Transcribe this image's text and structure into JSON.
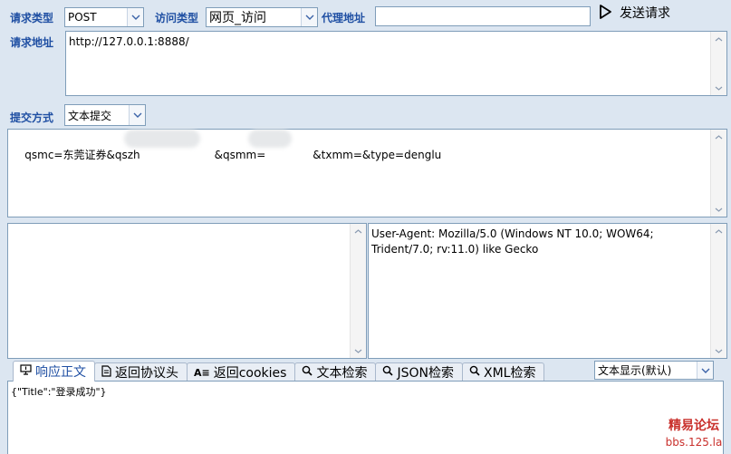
{
  "toolbar": {
    "request_type_label": "请求类型",
    "request_type_value": "POST",
    "access_type_label": "访问类型",
    "access_type_value": "网页_访问",
    "proxy_label": "代理地址",
    "proxy_value": "",
    "send_label": "发送请求"
  },
  "url": {
    "label": "请求地址",
    "value": "http://127.0.0.1:8888/"
  },
  "submit": {
    "label": "提交方式",
    "value": "文本提交",
    "body_parts": [
      "qsmc=东莞证券&qszh",
      "&qsmm=",
      "&txmm=&type=denglu"
    ]
  },
  "headers": {
    "left_value": "",
    "right_value": "User-Agent: Mozilla/5.0 (Windows NT 10.0; WOW64;\nTrident/7.0; rv:11.0) like Gecko"
  },
  "tabs": [
    {
      "label": "响应正文",
      "icon": "monitor-icon"
    },
    {
      "label": "返回协议头",
      "icon": "document-icon"
    },
    {
      "label": "返回cookies",
      "icon": "text-format-icon"
    },
    {
      "label": "文本检索",
      "icon": "search-icon"
    },
    {
      "label": "JSON检索",
      "icon": "search-icon"
    },
    {
      "label": "XML检索",
      "icon": "search-icon"
    }
  ],
  "display_mode": "文本显示(默认)",
  "response": {
    "value": "{\"Title\":\"登录成功\"}"
  },
  "watermark": {
    "line1": "精易论坛",
    "line2": "bbs.125.la"
  }
}
